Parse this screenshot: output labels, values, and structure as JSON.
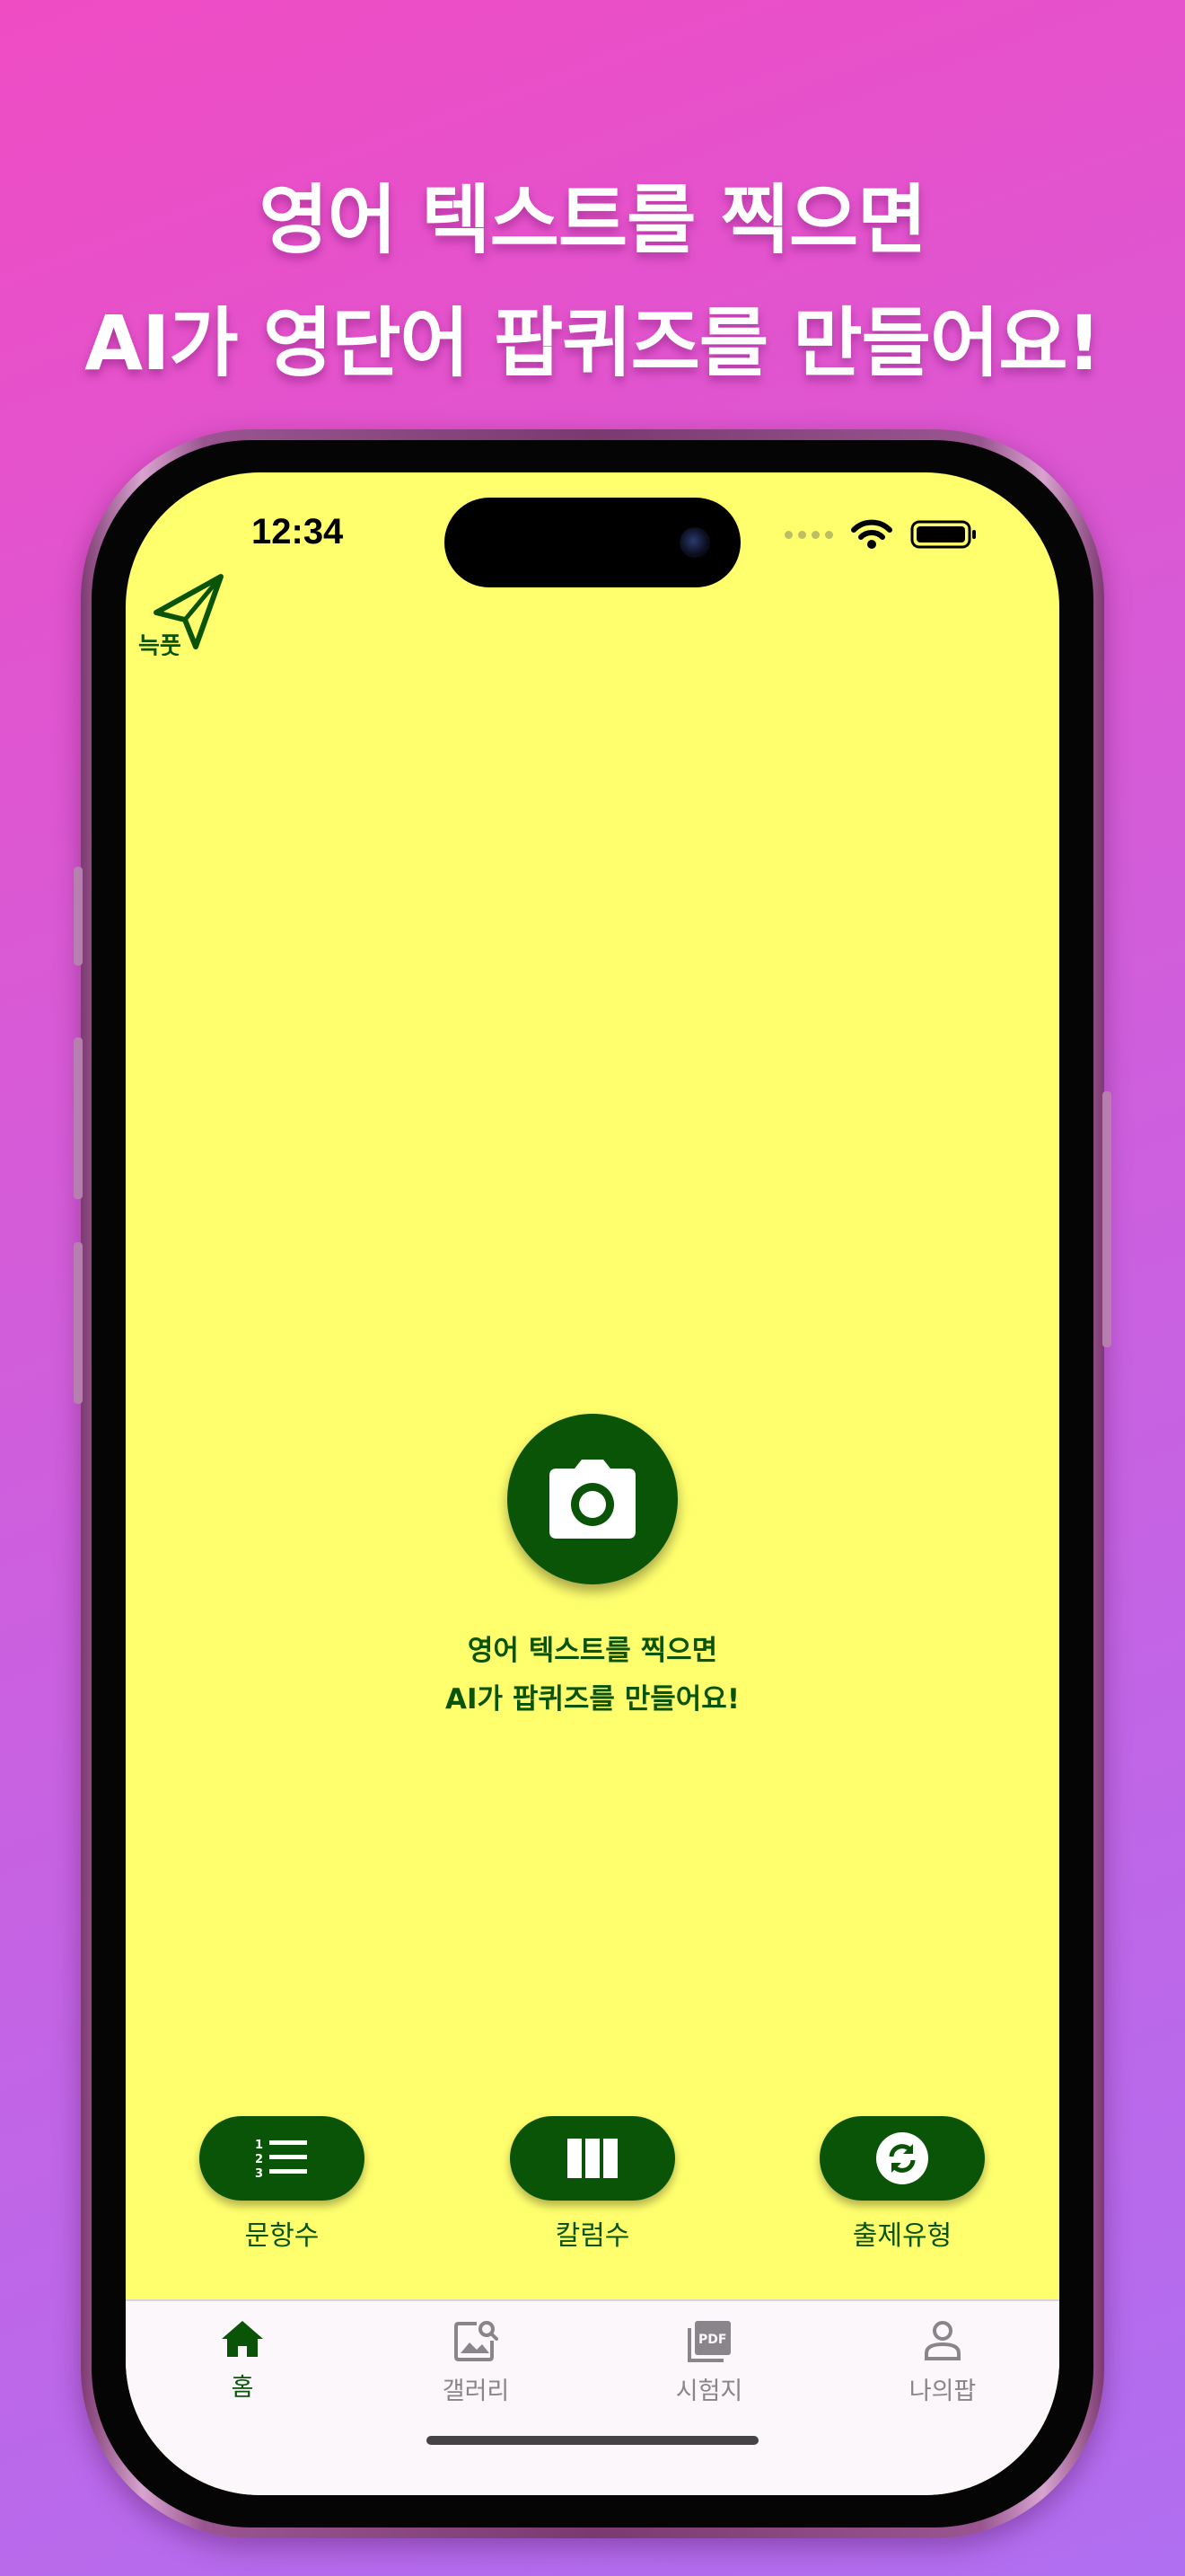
{
  "headline": {
    "line1": "영어 텍스트를 찍으면",
    "line2": "AI가 영단어 팝퀴즈를 만들어요!"
  },
  "status_bar": {
    "time": "12:34"
  },
  "app": {
    "logo_text": "늑풋",
    "capture": {
      "icon": "camera-icon",
      "prompt_line1": "영어 텍스트를 찍으면",
      "prompt_line2": "AI가 팝퀴즈를 만들어요!"
    },
    "options": [
      {
        "label": "문항수",
        "icon": "numbered-list-icon"
      },
      {
        "label": "칼럼수",
        "icon": "columns-icon"
      },
      {
        "label": "출제유형",
        "icon": "refresh-icon"
      }
    ],
    "tabs": [
      {
        "label": "홈",
        "icon": "home-icon",
        "active": true
      },
      {
        "label": "갤러리",
        "icon": "gallery-icon",
        "active": false
      },
      {
        "label": "시험지",
        "icon": "pdf-icon",
        "active": false
      },
      {
        "label": "나의팝",
        "icon": "person-icon",
        "active": false
      }
    ]
  },
  "colors": {
    "accent": "#0a5408",
    "screen_background": "#ffff6e",
    "tabbar_background": "#fcf7fb"
  }
}
